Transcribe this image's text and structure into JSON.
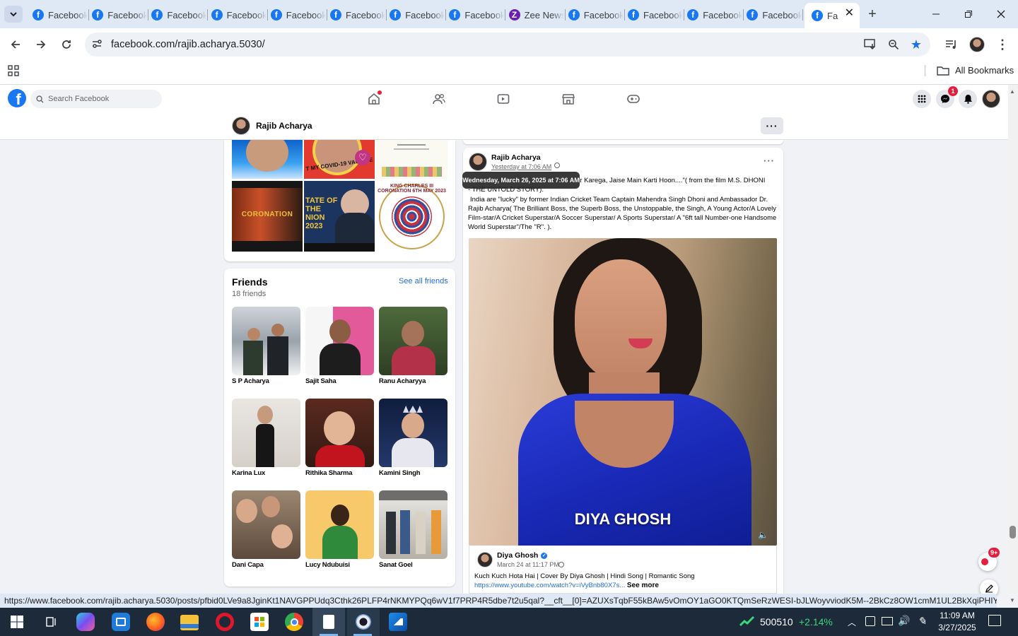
{
  "browser": {
    "tabs": [
      {
        "title": "Facebook"
      },
      {
        "title": "Facebook"
      },
      {
        "title": "Facebook"
      },
      {
        "title": "Facebook"
      },
      {
        "title": "Facebook"
      },
      {
        "title": "Facebook"
      },
      {
        "title": "Facebook"
      },
      {
        "title": "Facebook"
      },
      {
        "title": "Zee News"
      },
      {
        "title": "Facebook"
      },
      {
        "title": "Facebook"
      },
      {
        "title": "Facebook"
      },
      {
        "title": "Facebook"
      }
    ],
    "active_tab_title": "Fa",
    "url": "facebook.com/rajib.acharya.5030/",
    "bookmarks_label": "All Bookmarks",
    "status_url": "https://www.facebook.com/rajib.acharya.5030/posts/pfbid0LVe9a8JginKt1NAVGPPUdq3Cthk26PLFP4rNKMYPQq6wV1f7PRP4R5dbe7t2u5qal?__cft__[0]=AZUXsTqbF55kBAw5vOmOY1aGO0KTQmSeRzWESI-bJLWoyvviodK5M--2BkCz8OW1cmM1UL2BkXqiPHIYmcmAs..."
  },
  "facebook": {
    "search_placeholder": "Search Facebook",
    "messenger_badge": "1",
    "profile_name": "Rajib Acharya",
    "friends": {
      "heading": "Friends",
      "count": "18 friends",
      "see_all": "See all friends",
      "list": [
        "S P Acharya",
        "Sajit Saha",
        "Ranu Acharyya",
        "Karina Lux",
        "Rithika Sharma",
        "Kamini Singh",
        "Dani Capa",
        "Lucy Ndubuisi",
        "Sanat Goel"
      ]
    },
    "photos": {
      "covid_text": "T MY COVID-19 VACCINE",
      "coronation_text": "CORONATION",
      "state_text": "TATE OF THE NION 2023",
      "king_text": "KING CHARLES III CORONATION 6TH MAY 2023"
    },
    "post": {
      "author": "Rajib Acharya",
      "time": "Yesterday at 7:06 AM",
      "tooltip": "Wednesday, March 26, 2025 at 7:06 AM",
      "text_line1": "ar Karega, Jaise Main Karti Hoon....\"( from the film M.S. DHONI",
      "text_line2": "- THE UNTOLD STORY).",
      "text_body": "India are \"lucky\" by former Indian Cricket Team Captain Mahendra Singh Dhoni and Ambassador Dr. Rajib Acharya( The Brilliant Boss, the Superb Boss, the Unstoppable, the Singh, A Young Actor/A Lovely Film-star/A Cricket Superstar/A Soccer Superstar/ A Sports Superstar/ A \"6ft tall Number-one Handsome World Superstar\"/The \"R\". ).",
      "video_caption": "DIYA GHOSH",
      "shared": {
        "author": "Diya Ghosh",
        "date": "March 24 at 11:17 PM",
        "text": "Kuch Kuch Hota Hai | Cover By Diya Ghosh | Hindi Song | Romantic Song",
        "link": "https://www.youtube.com/watch?v=iVyBnb80X7s...",
        "see_more": "See more"
      }
    },
    "news_badge": "9+"
  },
  "taskbar": {
    "ticker_value": "500510",
    "ticker_change": "+2.14%",
    "time": "11:09 AM",
    "date": "3/27/2025"
  },
  "colors": {
    "fb_blue": "#1877f2",
    "tab_strip": "#dfe8f5",
    "taskbar": "#1c2a3a",
    "ticker_green": "#3ad67a"
  }
}
